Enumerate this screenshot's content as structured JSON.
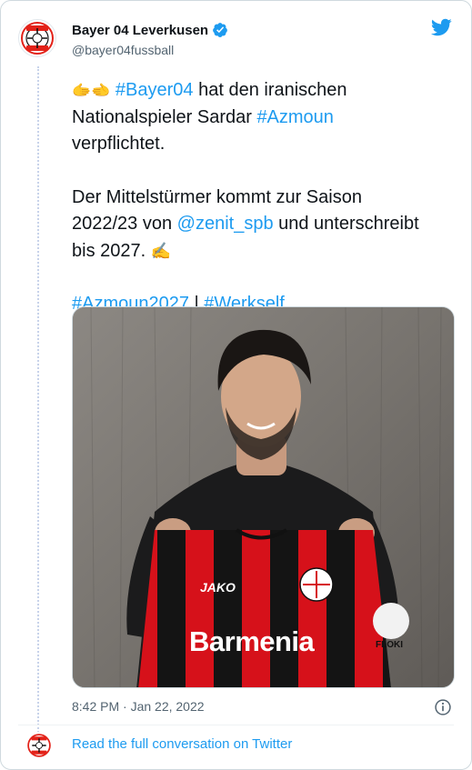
{
  "tweet": {
    "author_name": "Bayer 04 Leverkusen",
    "author_handle": "@bayer04fussball",
    "lines": {
      "l1_emoji": "🫱🫲",
      "l1_tag": "#Bayer04",
      "l1_rest": " hat den iranischen",
      "l2_pre": "Nationalspieler Sardar ",
      "l2_tag": "#Azmoun",
      "l3": "verpflichtet.",
      "l4": "Der Mittelstürmer kommt zur Saison",
      "l5_pre": "2022/23 von ",
      "l5_mention": "@zenit_spb",
      "l5_rest": " und unterschreibt",
      "l6_pre": "bis 2027. ",
      "l6_emoji": "✍️",
      "l7_tag1": "#Azmoun2027",
      "l7_sep": " | ",
      "l7_tag2": "#Werkself"
    },
    "timestamp": "8:42 PM · Jan 22, 2022"
  },
  "photo": {
    "jersey_sponsor": "Barmenia",
    "jersey_brand": "JAKO",
    "jersey_patch": "FLOKI"
  },
  "footer": {
    "link_text": "Read the full conversation on Twitter"
  },
  "colors": {
    "accent": "#1d9bf0",
    "text": "#0f1419",
    "muted": "#536471",
    "jersey_red": "#d6111a",
    "jersey_black": "#141414"
  },
  "icons": {
    "verified": "verified-badge-icon",
    "bird": "twitter-bird-icon",
    "info": "info-icon"
  }
}
